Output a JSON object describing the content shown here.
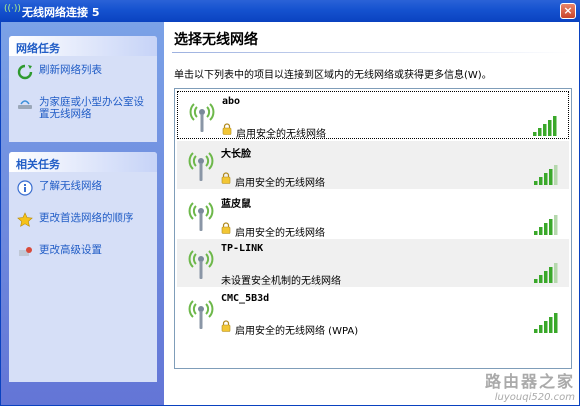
{
  "window": {
    "title": "无线网络连接 5",
    "close_label": "×",
    "app_icon_label": "((·))"
  },
  "left": {
    "network_tasks": {
      "title": "网络任务",
      "items": [
        {
          "label": "刷新网络列表",
          "icon": "refresh-icon"
        },
        {
          "label": "为家庭或小型办公室设置无线网络",
          "icon": "setup-network-icon"
        }
      ]
    },
    "related_tasks": {
      "title": "相关任务",
      "items": [
        {
          "label": "了解无线网络",
          "icon": "info-icon"
        },
        {
          "label": "更改首选网络的顺序",
          "icon": "star-icon"
        },
        {
          "label": "更改高级设置",
          "icon": "advanced-settings-icon"
        }
      ]
    }
  },
  "main": {
    "heading": "选择无线网络",
    "instruction": "单击以下列表中的项目以连接到区域内的无线网络或获得更多信息(W)。",
    "networks": [
      {
        "ssid": "abo",
        "security": "启用安全的无线网络",
        "secured": true,
        "signal_bars": 5
      },
      {
        "ssid": "大长脸",
        "security": "启用安全的无线网络",
        "secured": true,
        "signal_bars": 4
      },
      {
        "ssid": "蓝皮鼠",
        "security": "启用安全的无线网络",
        "secured": true,
        "signal_bars": 4
      },
      {
        "ssid": "TP-LINK",
        "security": "未设置安全机制的无线网络",
        "secured": false,
        "signal_bars": 4
      },
      {
        "ssid": "CMC_5B3d",
        "security": "启用安全的无线网络 (WPA)",
        "secured": true,
        "signal_bars": 5
      }
    ]
  },
  "watermark": {
    "line1": "路由器之家",
    "line2": "luyouqi520.com"
  },
  "colors": {
    "link": "#215dc6",
    "signal": "#3aa82a",
    "signal_dim": "#b5d8ad",
    "antenna": "#6db84a"
  }
}
